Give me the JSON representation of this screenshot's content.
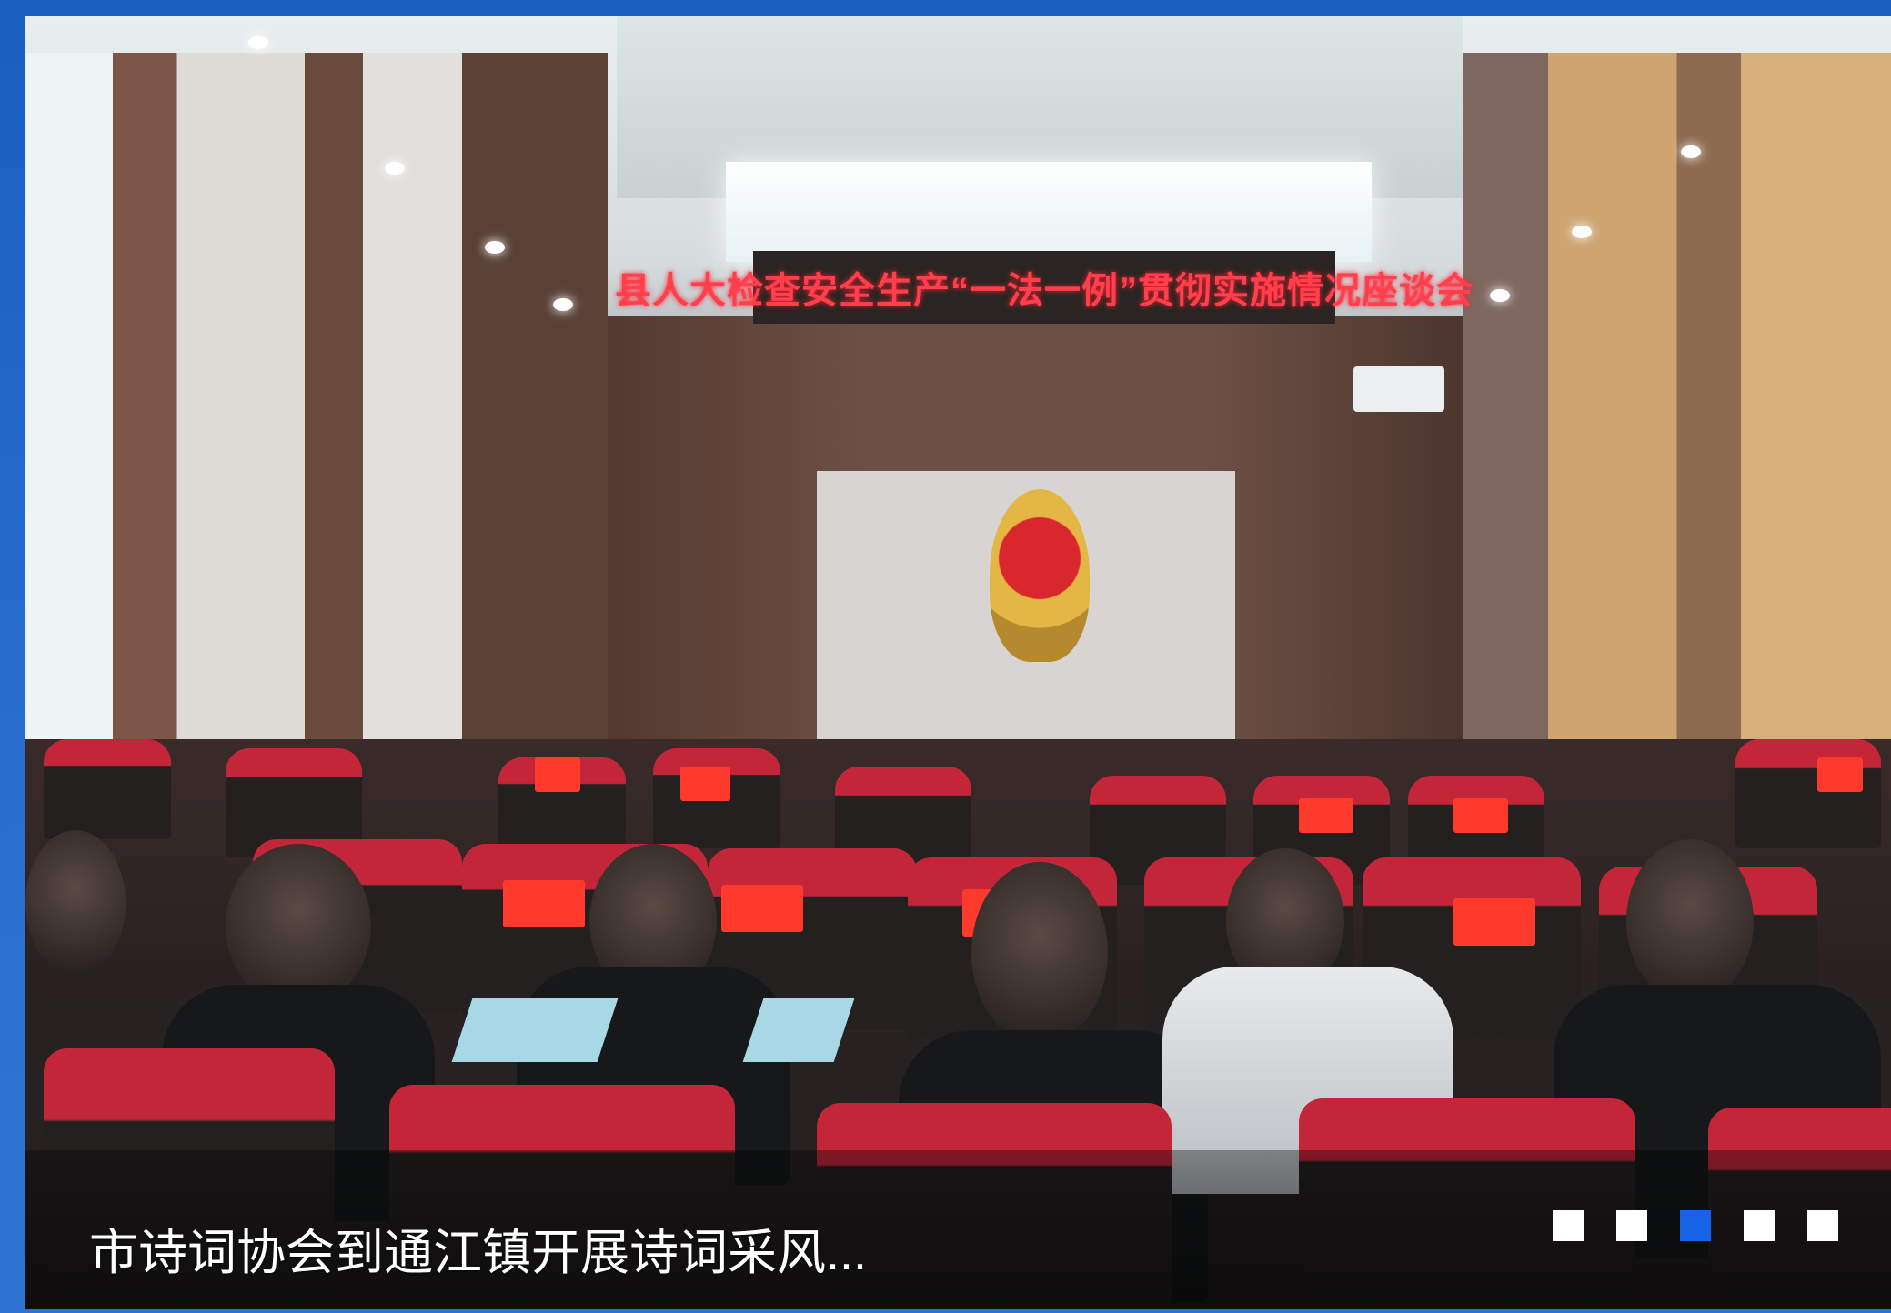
{
  "banner": {
    "led_sign_text": "县人大检查安全生产“一法一例”贯彻实施情况座谈会",
    "caption": "市诗词协会到通江镇开展诗词采风...",
    "active_slide": 3,
    "slide_count": 5,
    "indicator_color": "#ffffff",
    "indicator_active_color": "#1565e6",
    "frame_color": "#1a5fbf"
  }
}
